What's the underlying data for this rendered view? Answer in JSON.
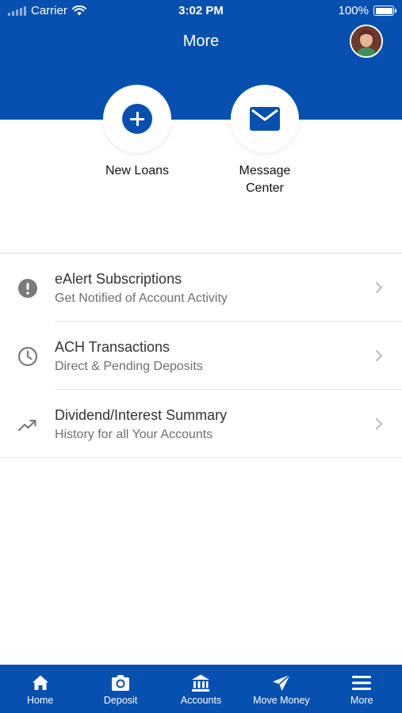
{
  "status_bar": {
    "carrier": "Carrier",
    "time": "3:02 PM",
    "battery": "100%"
  },
  "header": {
    "title": "More"
  },
  "quick_actions": [
    {
      "label": "New Loans",
      "icon": "plus-circle-icon"
    },
    {
      "label": "Message Center",
      "label_line1": "Message",
      "label_line2": "Center",
      "icon": "envelope-icon"
    }
  ],
  "menu": {
    "items": [
      {
        "title": "eAlert Subscriptions",
        "subtitle": "Get Notified of Account Activity",
        "icon": "alert-icon"
      },
      {
        "title": "ACH Transactions",
        "subtitle": "Direct & Pending Deposits",
        "icon": "clock-icon"
      },
      {
        "title": "Dividend/Interest Summary",
        "subtitle": "History for all Your Accounts",
        "icon": "trending-up-icon"
      }
    ]
  },
  "tab_bar": {
    "active": "More",
    "tabs": [
      {
        "label": "Home",
        "icon": "home-icon"
      },
      {
        "label": "Deposit",
        "icon": "camera-icon"
      },
      {
        "label": "Accounts",
        "icon": "bank-icon"
      },
      {
        "label": "Move Money",
        "icon": "send-icon"
      },
      {
        "label": "More",
        "icon": "menu-icon"
      }
    ]
  },
  "colors": {
    "brand_blue": "#0850b0",
    "icon_gray": "#7a7a7a",
    "chevron_gray": "#b8b8b8",
    "text_dark": "#333333",
    "text_muted": "#6f6f6f"
  }
}
